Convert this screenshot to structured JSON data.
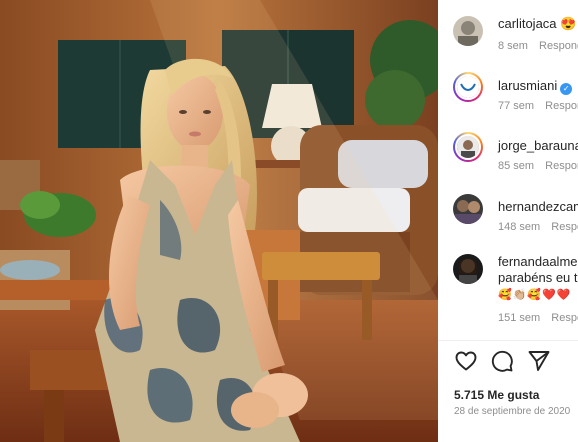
{
  "post": {
    "image_alt": "Young woman with long blond hair in a floral halter dress sitting on a wooden bench on a sunlit terrace"
  },
  "comments": [
    {
      "username": "carlitojaca",
      "text": "😍",
      "age": "8 sem",
      "reply": "Responder"
    },
    {
      "username": "larusmiani",
      "verified": "✓",
      "text": "",
      "age": "77 sem",
      "reply": "Responder"
    },
    {
      "username": "jorge_barauna",
      "text": "",
      "age": "85 sem",
      "reply": "Responder"
    },
    {
      "username": "hernandezcampos",
      "text": "",
      "age": "148 sem",
      "reply": "Responder"
    },
    {
      "username": "fernandaalmeida",
      "text": "parabéns eu te amo",
      "emojis": "🥰👏🏼🥰❤️❤️",
      "age": "151 sem",
      "reply": "Responder"
    }
  ],
  "actions": {
    "like_icon": "heart-outline-icon",
    "comment_icon": "comment-bubble-icon",
    "share_icon": "paper-plane-icon"
  },
  "stats": {
    "likes": "5.715 Me gusta",
    "date": "28 de septiembre de 2020"
  },
  "colors": {
    "text": "#262626",
    "secondary": "#8e8e8e",
    "verified": "#3897f0"
  }
}
